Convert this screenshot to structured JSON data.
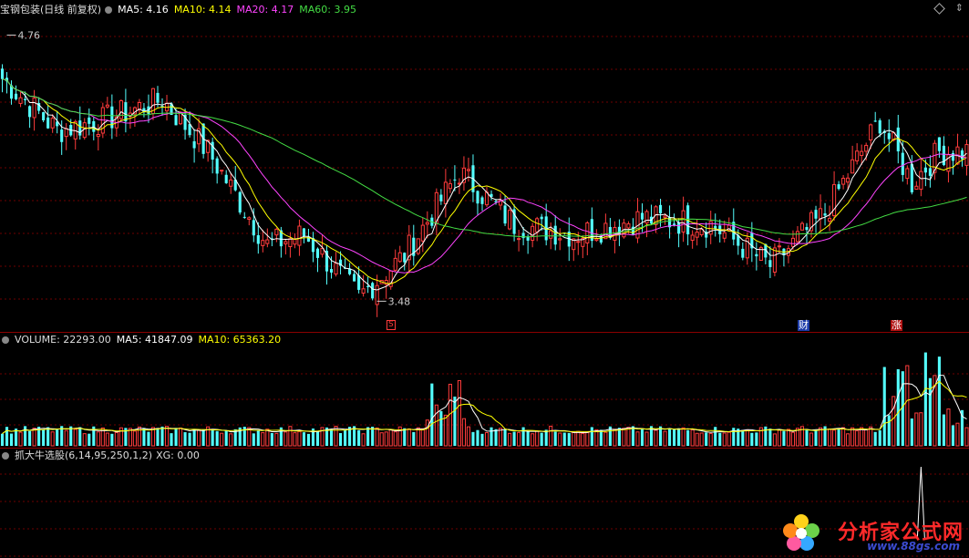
{
  "headers": {
    "main": {
      "name": "宝钢包装(日线 前复权)",
      "ma5": "MA5: 4.16",
      "ma10": "MA10: 4.14",
      "ma20": "MA20: 4.17",
      "ma60": "MA60: 3.95"
    },
    "volume": {
      "vol": "VOLUME: 22293.00",
      "ma5": "MA5: 41847.09",
      "ma10": "MA10: 65363.20"
    },
    "indicator": {
      "name": "抓大牛选股(6,14,95,250,1,2)",
      "xg": "XG: 0.00"
    }
  },
  "markers": {
    "high_label": "4.76",
    "low_label": "3.48",
    "s_mark": "S",
    "cai_mark": "财",
    "zhang_mark": "涨"
  },
  "logo": {
    "name": "分析家公式网",
    "url": "www.88gs.com"
  },
  "colors": {
    "up": "#ff3c3c",
    "down": "#54ffff",
    "ma5": "#ffffff",
    "ma10": "#ffff00",
    "ma20": "#ff44ff",
    "ma60": "#44dd44",
    "grid": "#6e0000"
  },
  "chart_data": [
    {
      "type": "candlestick",
      "title": "宝钢包装(日线 前复权)",
      "ylim": [
        3.35,
        4.85
      ],
      "grid": true,
      "annotations": [
        {
          "label": "4.76",
          "value": 4.76
        },
        {
          "label": "3.48",
          "value": 3.48
        }
      ],
      "keypoints": [
        [
          0,
          4.55
        ],
        [
          12,
          4.3
        ],
        [
          22,
          4.35
        ],
        [
          35,
          4.45
        ],
        [
          45,
          4.2
        ],
        [
          58,
          3.75
        ],
        [
          66,
          3.8
        ],
        [
          78,
          3.5
        ],
        [
          88,
          3.7
        ],
        [
          100,
          4.1
        ],
        [
          112,
          3.85
        ],
        [
          125,
          3.8
        ],
        [
          140,
          3.88
        ],
        [
          155,
          3.85
        ],
        [
          168,
          3.65
        ],
        [
          180,
          3.9
        ],
        [
          192,
          4.35
        ],
        [
          199,
          4.05
        ],
        [
          205,
          4.2
        ]
      ],
      "series": [
        {
          "name": "MA5",
          "value": 4.16
        },
        {
          "name": "MA10",
          "value": 4.14
        },
        {
          "name": "MA20",
          "value": 4.17
        },
        {
          "name": "MA60",
          "value": 3.95
        }
      ]
    },
    {
      "type": "bar",
      "title": "VOLUME",
      "last_value": 22293.0,
      "series": [
        {
          "name": "MA5",
          "value": 41847.09
        },
        {
          "name": "MA10",
          "value": 65363.2
        }
      ]
    },
    {
      "type": "line",
      "title": "抓大牛选股(6,14,95,250,1,2)",
      "series": [
        {
          "name": "XG",
          "value": 0.0
        }
      ]
    }
  ]
}
